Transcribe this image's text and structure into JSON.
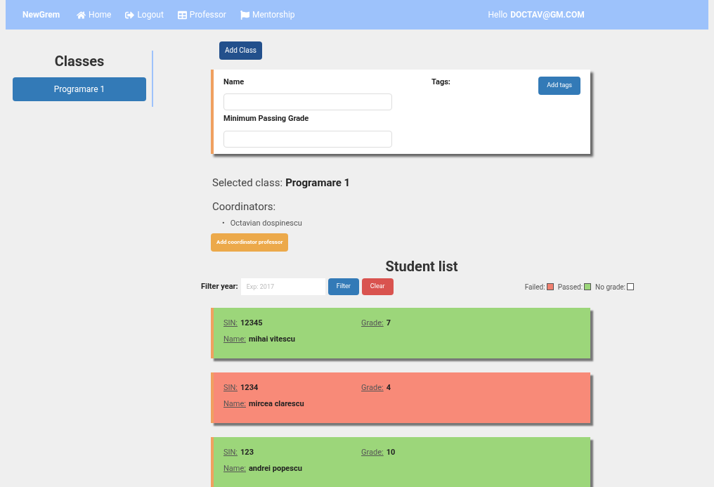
{
  "navbar": {
    "brand": "NewGrem",
    "links": [
      {
        "label": "Home",
        "kind": "home"
      },
      {
        "label": "Logout",
        "kind": "logout"
      },
      {
        "label": "Professor",
        "kind": "table"
      },
      {
        "label": "Mentorship",
        "kind": "flag"
      }
    ],
    "greeting": "Hello",
    "user": "DOCTAV@GM.COM"
  },
  "sidebar": {
    "title": "Classes",
    "items": [
      {
        "label": "Programare 1",
        "selected": true
      }
    ]
  },
  "add_class_button": "Add Class",
  "class_form": {
    "name_label": "Name",
    "min_grade_label": "Minimum Passing Grade",
    "tags_label": "Tags:",
    "add_tags_button": "Add tags"
  },
  "selected_class": {
    "label": "Selected class:",
    "value": "Programare 1"
  },
  "coordinators": {
    "title": "Coordinators:",
    "bullet": "•",
    "items": [
      "Octavian dospinescu"
    ],
    "add_button": "Add coordinator professor"
  },
  "student_list": {
    "title": "Student list",
    "filter_label": "Filter year:",
    "filter_placeholder": "Exp: 2017",
    "filter_button": "Filter",
    "clear_button": "Clear",
    "legend": [
      {
        "label": "Failed:",
        "color": "#f08070"
      },
      {
        "label": "Passed:",
        "color": "#9cd67a"
      },
      {
        "label": "No grade:",
        "color": "#ffffff"
      }
    ],
    "students": [
      {
        "color": "#9cd67a",
        "sin_label": "SIN:",
        "sin": "12345",
        "grade_label": "Grade:",
        "grade": "7",
        "name_label": "Name:",
        "name": "mihai vitescu"
      },
      {
        "color": "#f88a78",
        "sin_label": "SIN:",
        "sin": "1234",
        "grade_label": "Grade:",
        "grade": "4",
        "name_label": "Name:",
        "name": "mircea clarescu"
      },
      {
        "color": "#9cd67a",
        "sin_label": "SIN:",
        "sin": "123",
        "grade_label": "Grade:",
        "grade": "10",
        "name_label": "Name:",
        "name": "andrei popescu"
      }
    ]
  }
}
